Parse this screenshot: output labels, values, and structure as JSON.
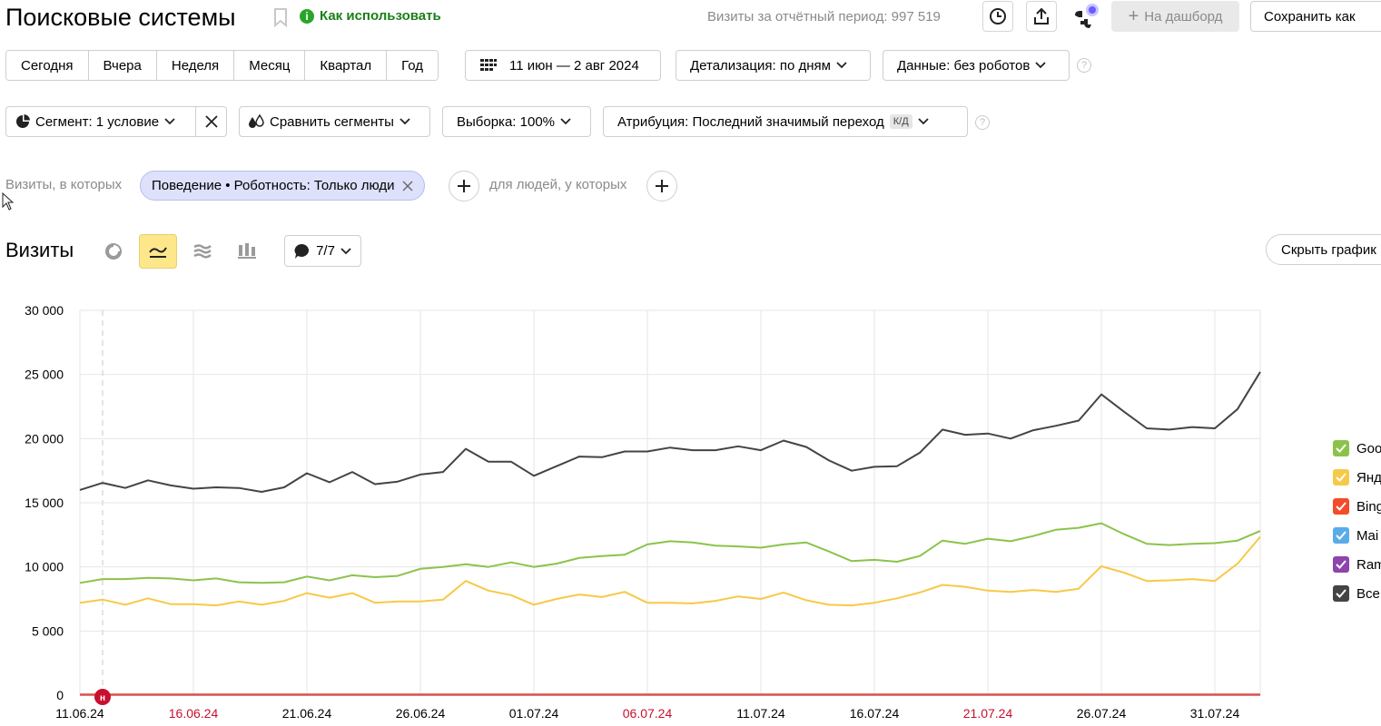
{
  "header": {
    "title": "Поисковые системы",
    "howto": "Как использовать",
    "visits_label": "Визиты за отчётный период: 997 519",
    "dashboard_button": "На дашборд",
    "save_button": "Сохранить как"
  },
  "periods": [
    "Сегодня",
    "Вчера",
    "Неделя",
    "Месяц",
    "Квартал",
    "Год"
  ],
  "date_range": "11 июн — 2 авг 2024",
  "detail": "Детализация: по дням",
  "data_filter": "Данные: без роботов",
  "segment": "Сегмент: 1 условие",
  "compare": "Сравнить сегменты",
  "sample": "Выборка: 100%",
  "attribution": "Атрибуция: Последний значимый переход",
  "attribution_badge": "К/Д",
  "filters": {
    "visits_prefix": "Визиты, в которых",
    "chip": "Поведение • Роботность: Только люди",
    "people_prefix": "для людей, у которых"
  },
  "chart_section": {
    "title": "Визиты",
    "annotations_count": "7/7",
    "hide_button": "Скрыть график"
  },
  "colors": {
    "google": "#8bc34a",
    "yandex": "#f7c948",
    "bing": "#f44b2b",
    "mail": "#5aace9",
    "rambler": "#8e44ad",
    "total": "#444444",
    "active_view": "#fde78a",
    "howto_green": "#1a7f17",
    "weekend_red": "#c8102e"
  },
  "legend": [
    {
      "label": "Goo",
      "color": "#8bc34a"
    },
    {
      "label": "Янд",
      "color": "#f7c948"
    },
    {
      "label": "Bing",
      "color": "#f44b2b"
    },
    {
      "label": "Mai",
      "color": "#5aace9"
    },
    {
      "label": "Ram",
      "color": "#8e44ad"
    },
    {
      "label": "Все",
      "color": "#444444"
    }
  ],
  "chart_data": {
    "type": "line",
    "ylim": [
      0,
      30000
    ],
    "y_ticks": [
      "0",
      "5 000",
      "10 000",
      "15 000",
      "20 000",
      "25 000",
      "30 000"
    ],
    "y_tick_values": [
      0,
      5000,
      10000,
      15000,
      20000,
      25000,
      30000
    ],
    "x_ticks": [
      {
        "label": "11.06.24",
        "day": 0,
        "weekend": false
      },
      {
        "label": "16.06.24",
        "day": 5,
        "weekend": true
      },
      {
        "label": "21.06.24",
        "day": 10,
        "weekend": false
      },
      {
        "label": "26.06.24",
        "day": 15,
        "weekend": false
      },
      {
        "label": "01.07.24",
        "day": 20,
        "weekend": false
      },
      {
        "label": "06.07.24",
        "day": 25,
        "weekend": true
      },
      {
        "label": "11.07.24",
        "day": 30,
        "weekend": false
      },
      {
        "label": "16.07.24",
        "day": 35,
        "weekend": false
      },
      {
        "label": "21.07.24",
        "day": 40,
        "weekend": true
      },
      {
        "label": "26.07.24",
        "day": 45,
        "weekend": false
      },
      {
        "label": "31.07.24",
        "day": 50,
        "weekend": false
      }
    ],
    "marker": {
      "label": "н",
      "day": 1
    },
    "series": [
      {
        "key": "total",
        "color": "#444444",
        "values": [
          16000,
          16550,
          16150,
          16750,
          16350,
          16100,
          16200,
          16150,
          15850,
          16200,
          17300,
          16600,
          17400,
          16450,
          16650,
          17200,
          17400,
          19200,
          18200,
          18200,
          17100,
          17850,
          18600,
          18550,
          19000,
          19000,
          19300,
          19100,
          19100,
          19400,
          19100,
          19850,
          19350,
          18300,
          17500,
          17800,
          17850,
          18900,
          20700,
          20300,
          20400,
          20000,
          20650,
          21000,
          21400,
          23450,
          22100,
          20800,
          20700,
          20900,
          20800,
          22300,
          25200
        ]
      },
      {
        "key": "google",
        "color": "#8bc34a",
        "values": [
          8750,
          9050,
          9050,
          9150,
          9100,
          8950,
          9100,
          8800,
          8750,
          8800,
          9250,
          8950,
          9350,
          9200,
          9300,
          9850,
          10000,
          10200,
          10000,
          10350,
          10000,
          10250,
          10700,
          10850,
          10950,
          11750,
          12000,
          11900,
          11650,
          11600,
          11500,
          11750,
          11900,
          11200,
          10450,
          10550,
          10400,
          10850,
          12050,
          11800,
          12200,
          12000,
          12400,
          12900,
          13050,
          13400,
          12550,
          11800,
          11700,
          11800,
          11850,
          12050,
          12800
        ]
      },
      {
        "key": "yandex",
        "color": "#f7c948",
        "values": [
          7200,
          7450,
          7050,
          7550,
          7100,
          7100,
          7000,
          7300,
          7050,
          7350,
          7950,
          7600,
          7950,
          7200,
          7300,
          7300,
          7450,
          8900,
          8150,
          7800,
          7050,
          7500,
          7850,
          7650,
          8050,
          7200,
          7200,
          7150,
          7350,
          7700,
          7500,
          8000,
          7400,
          7050,
          7000,
          7200,
          7550,
          8000,
          8600,
          8450,
          8150,
          8050,
          8200,
          8050,
          8300,
          10050,
          9550,
          8900,
          8950,
          9050,
          8900,
          10250,
          12350
        ]
      },
      {
        "key": "bing",
        "color": "#f44b2b",
        "values": [
          60,
          60,
          60,
          60,
          60,
          60,
          60,
          60,
          60,
          60,
          60,
          60,
          60,
          60,
          60,
          60,
          60,
          60,
          60,
          60,
          60,
          60,
          60,
          60,
          60,
          60,
          60,
          60,
          60,
          60,
          60,
          60,
          60,
          60,
          60,
          60,
          60,
          60,
          60,
          60,
          60,
          60,
          60,
          60,
          60,
          60,
          60,
          60,
          60,
          60,
          60,
          60,
          60
        ]
      },
      {
        "key": "mail",
        "color": "#5aace9",
        "values": [
          40,
          40,
          40,
          40,
          40,
          40,
          40,
          40,
          40,
          40,
          40,
          40,
          40,
          40,
          40,
          40,
          40,
          40,
          40,
          40,
          40,
          40,
          40,
          40,
          40,
          40,
          40,
          40,
          40,
          40,
          40,
          40,
          40,
          40,
          40,
          40,
          40,
          40,
          40,
          40,
          40,
          40,
          40,
          40,
          40,
          40,
          40,
          40,
          40,
          40,
          40,
          40,
          40
        ]
      },
      {
        "key": "rambler",
        "color": "#8e44ad",
        "values": [
          20,
          20,
          20,
          20,
          20,
          20,
          20,
          20,
          20,
          20,
          20,
          20,
          20,
          20,
          20,
          20,
          20,
          20,
          20,
          20,
          20,
          20,
          20,
          20,
          20,
          20,
          20,
          20,
          20,
          20,
          20,
          20,
          20,
          20,
          20,
          20,
          20,
          20,
          20,
          20,
          20,
          20,
          20,
          20,
          20,
          20,
          20,
          20,
          20,
          20,
          20,
          20,
          20
        ]
      }
    ]
  }
}
